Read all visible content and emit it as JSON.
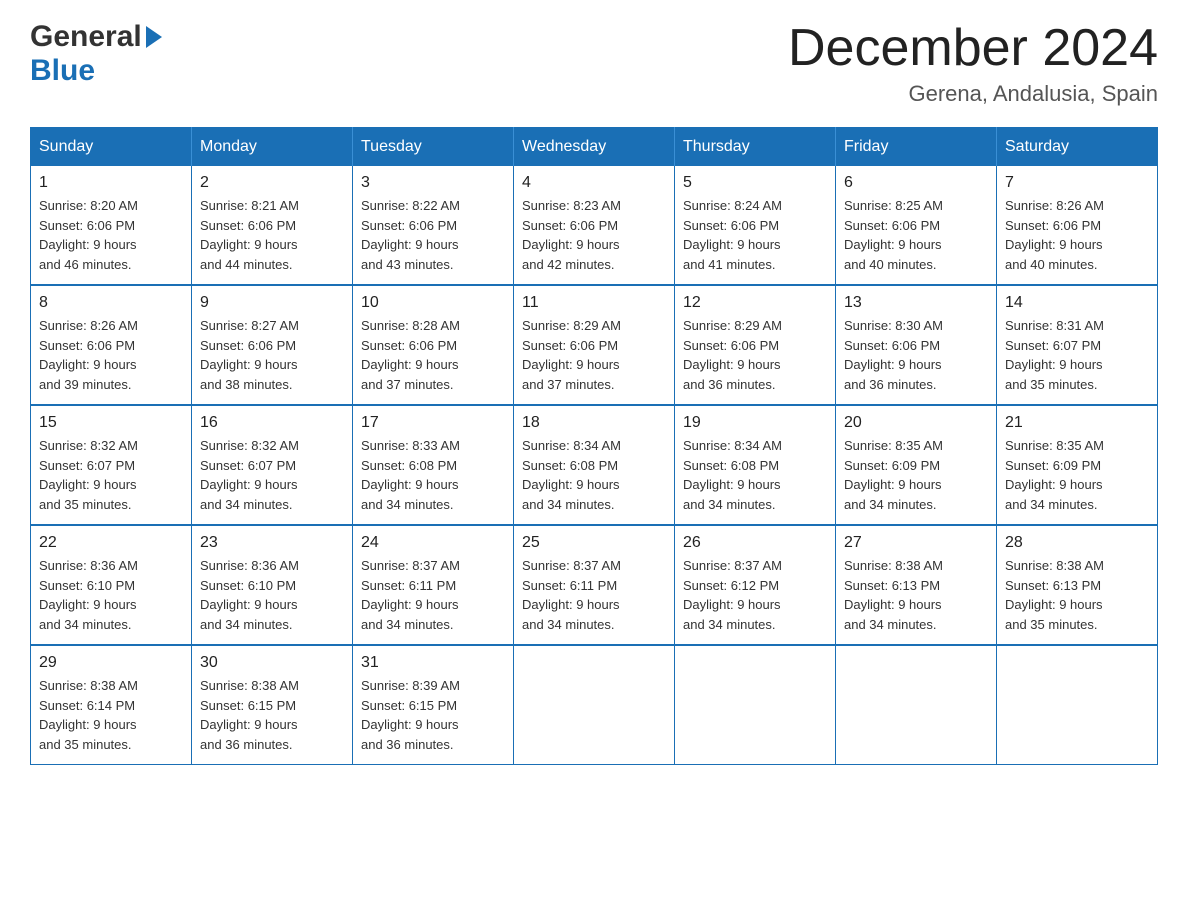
{
  "logo": {
    "general": "General",
    "blue": "Blue"
  },
  "header": {
    "month": "December 2024",
    "location": "Gerena, Andalusia, Spain"
  },
  "days_of_week": [
    "Sunday",
    "Monday",
    "Tuesday",
    "Wednesday",
    "Thursday",
    "Friday",
    "Saturday"
  ],
  "weeks": [
    [
      {
        "day": "1",
        "sunrise": "8:20 AM",
        "sunset": "6:06 PM",
        "daylight": "9 hours and 46 minutes."
      },
      {
        "day": "2",
        "sunrise": "8:21 AM",
        "sunset": "6:06 PM",
        "daylight": "9 hours and 44 minutes."
      },
      {
        "day": "3",
        "sunrise": "8:22 AM",
        "sunset": "6:06 PM",
        "daylight": "9 hours and 43 minutes."
      },
      {
        "day": "4",
        "sunrise": "8:23 AM",
        "sunset": "6:06 PM",
        "daylight": "9 hours and 42 minutes."
      },
      {
        "day": "5",
        "sunrise": "8:24 AM",
        "sunset": "6:06 PM",
        "daylight": "9 hours and 41 minutes."
      },
      {
        "day": "6",
        "sunrise": "8:25 AM",
        "sunset": "6:06 PM",
        "daylight": "9 hours and 40 minutes."
      },
      {
        "day": "7",
        "sunrise": "8:26 AM",
        "sunset": "6:06 PM",
        "daylight": "9 hours and 40 minutes."
      }
    ],
    [
      {
        "day": "8",
        "sunrise": "8:26 AM",
        "sunset": "6:06 PM",
        "daylight": "9 hours and 39 minutes."
      },
      {
        "day": "9",
        "sunrise": "8:27 AM",
        "sunset": "6:06 PM",
        "daylight": "9 hours and 38 minutes."
      },
      {
        "day": "10",
        "sunrise": "8:28 AM",
        "sunset": "6:06 PM",
        "daylight": "9 hours and 37 minutes."
      },
      {
        "day": "11",
        "sunrise": "8:29 AM",
        "sunset": "6:06 PM",
        "daylight": "9 hours and 37 minutes."
      },
      {
        "day": "12",
        "sunrise": "8:29 AM",
        "sunset": "6:06 PM",
        "daylight": "9 hours and 36 minutes."
      },
      {
        "day": "13",
        "sunrise": "8:30 AM",
        "sunset": "6:06 PM",
        "daylight": "9 hours and 36 minutes."
      },
      {
        "day": "14",
        "sunrise": "8:31 AM",
        "sunset": "6:07 PM",
        "daylight": "9 hours and 35 minutes."
      }
    ],
    [
      {
        "day": "15",
        "sunrise": "8:32 AM",
        "sunset": "6:07 PM",
        "daylight": "9 hours and 35 minutes."
      },
      {
        "day": "16",
        "sunrise": "8:32 AM",
        "sunset": "6:07 PM",
        "daylight": "9 hours and 34 minutes."
      },
      {
        "day": "17",
        "sunrise": "8:33 AM",
        "sunset": "6:08 PM",
        "daylight": "9 hours and 34 minutes."
      },
      {
        "day": "18",
        "sunrise": "8:34 AM",
        "sunset": "6:08 PM",
        "daylight": "9 hours and 34 minutes."
      },
      {
        "day": "19",
        "sunrise": "8:34 AM",
        "sunset": "6:08 PM",
        "daylight": "9 hours and 34 minutes."
      },
      {
        "day": "20",
        "sunrise": "8:35 AM",
        "sunset": "6:09 PM",
        "daylight": "9 hours and 34 minutes."
      },
      {
        "day": "21",
        "sunrise": "8:35 AM",
        "sunset": "6:09 PM",
        "daylight": "9 hours and 34 minutes."
      }
    ],
    [
      {
        "day": "22",
        "sunrise": "8:36 AM",
        "sunset": "6:10 PM",
        "daylight": "9 hours and 34 minutes."
      },
      {
        "day": "23",
        "sunrise": "8:36 AM",
        "sunset": "6:10 PM",
        "daylight": "9 hours and 34 minutes."
      },
      {
        "day": "24",
        "sunrise": "8:37 AM",
        "sunset": "6:11 PM",
        "daylight": "9 hours and 34 minutes."
      },
      {
        "day": "25",
        "sunrise": "8:37 AM",
        "sunset": "6:11 PM",
        "daylight": "9 hours and 34 minutes."
      },
      {
        "day": "26",
        "sunrise": "8:37 AM",
        "sunset": "6:12 PM",
        "daylight": "9 hours and 34 minutes."
      },
      {
        "day": "27",
        "sunrise": "8:38 AM",
        "sunset": "6:13 PM",
        "daylight": "9 hours and 34 minutes."
      },
      {
        "day": "28",
        "sunrise": "8:38 AM",
        "sunset": "6:13 PM",
        "daylight": "9 hours and 35 minutes."
      }
    ],
    [
      {
        "day": "29",
        "sunrise": "8:38 AM",
        "sunset": "6:14 PM",
        "daylight": "9 hours and 35 minutes."
      },
      {
        "day": "30",
        "sunrise": "8:38 AM",
        "sunset": "6:15 PM",
        "daylight": "9 hours and 36 minutes."
      },
      {
        "day": "31",
        "sunrise": "8:39 AM",
        "sunset": "6:15 PM",
        "daylight": "9 hours and 36 minutes."
      },
      null,
      null,
      null,
      null
    ]
  ],
  "labels": {
    "sunrise": "Sunrise:",
    "sunset": "Sunset:",
    "daylight": "Daylight:"
  }
}
